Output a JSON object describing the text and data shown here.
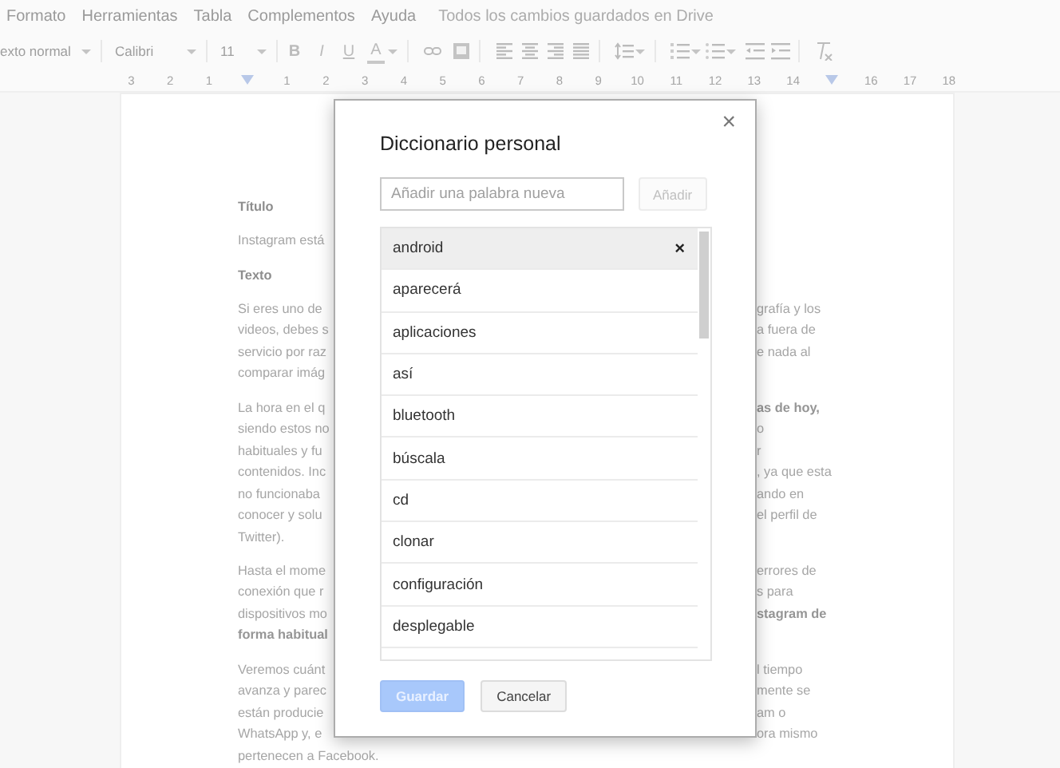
{
  "menu": [
    "Formato",
    "Herramientas",
    "Tabla",
    "Complementos",
    "Ayuda"
  ],
  "save_status": "Todos los cambios guardados en Drive",
  "toolbar": {
    "style": "exto normal",
    "font": "Calibri",
    "size": "11",
    "format_buttons": [
      "B",
      "I",
      "U",
      "A"
    ]
  },
  "ruler": [
    "3",
    "2",
    "1",
    "1",
    "2",
    "3",
    "4",
    "5",
    "6",
    "7",
    "8",
    "9",
    "10",
    "11",
    "12",
    "13",
    "14",
    "16",
    "17",
    "18"
  ],
  "document": [
    {
      "kind": "heading",
      "lines": [
        {
          "left": {
            "text": "Título",
            "bold": true
          }
        }
      ]
    },
    {
      "kind": "body",
      "lines": [
        {
          "left": {
            "text": "Instagram está",
            "bold": false
          }
        }
      ]
    },
    {
      "kind": "heading",
      "lines": [
        {
          "left": {
            "text": "Texto",
            "bold": true
          }
        }
      ]
    },
    {
      "kind": "body",
      "lines": [
        {
          "left": {
            "text": "Si eres uno de",
            "bold": false
          },
          "right": {
            "text": "grafía y los",
            "bold": false
          }
        },
        {
          "left": {
            "text": "videos, debes s",
            "bold": false
          },
          "right": {
            "text": "a fuera de",
            "bold": false
          }
        },
        {
          "left": {
            "text": "servicio por raz",
            "bold": false
          },
          "right": {
            "text": "e nada al",
            "bold": false
          }
        },
        {
          "left": {
            "text": "comparar imág",
            "bold": false
          }
        }
      ]
    },
    {
      "kind": "body",
      "lines": [
        {
          "left": {
            "text": "La hora en el q",
            "bold": false
          },
          "right": {
            "text": "as de hoy,",
            "bold": true
          }
        },
        {
          "left": {
            "text": "siendo estos no",
            "bold": false
          },
          "right": {
            "text": "o",
            "bold": false
          }
        },
        {
          "left": {
            "text": "habituales y fu",
            "bold": false
          },
          "right": {
            "text": "r",
            "bold": false
          }
        },
        {
          "left": {
            "text": "contenidos. Inc",
            "bold": false
          },
          "right": {
            "text": ", ya que esta",
            "bold": false
          }
        },
        {
          "left": {
            "text": "no funcionaba",
            "bold": false
          },
          "right": {
            "text": "ando en",
            "bold": false
          }
        },
        {
          "left": {
            "text": "conocer y solu",
            "bold": false
          },
          "right": {
            "text": "el perfil de",
            "bold": false
          }
        },
        {
          "left": {
            "text": "Twitter).",
            "bold": false
          }
        }
      ]
    },
    {
      "kind": "body",
      "lines": [
        {
          "left": {
            "text": "Hasta el mome",
            "bold": false
          },
          "right": {
            "text": "errores de",
            "bold": false
          }
        },
        {
          "left": {
            "text": "conexión que r",
            "bold": false
          },
          "right": {
            "text": "s para",
            "bold": false
          }
        },
        {
          "left": {
            "text": "dispositivos mo",
            "bold": false
          },
          "right": {
            "text": "stagram de",
            "bold": true
          }
        },
        {
          "left": {
            "text": "forma habitual",
            "bold": true
          }
        }
      ]
    },
    {
      "kind": "body",
      "lines": [
        {
          "left": {
            "text": "Veremos cuánt",
            "bold": false
          },
          "right": {
            "text": "l tiempo",
            "bold": false
          }
        },
        {
          "left": {
            "text": "avanza y parec",
            "bold": false
          },
          "right": {
            "text": "mente se",
            "bold": false
          }
        },
        {
          "left": {
            "text": "están producie",
            "bold": false
          },
          "right": {
            "text": "am o",
            "bold": false
          }
        },
        {
          "left": {
            "text": "WhatsApp y, e",
            "bold": false
          },
          "right": {
            "text": "ora mismo",
            "bold": false
          }
        },
        {
          "left": {
            "text": "pertenecen a Facebook.",
            "bold": false
          }
        }
      ]
    }
  ],
  "dialog": {
    "title": "Diccionario personal",
    "close": "×",
    "new_word": {
      "placeholder": "Añadir una palabra nueva"
    },
    "add_button": {
      "label": "Añadir",
      "disabled": true
    },
    "words": [
      {
        "word": "android",
        "selected": true
      },
      {
        "word": "aparecerá",
        "selected": false
      },
      {
        "word": "aplicaciones",
        "selected": false
      },
      {
        "word": "así",
        "selected": false
      },
      {
        "word": "bluetooth",
        "selected": false
      },
      {
        "word": "búscala",
        "selected": false
      },
      {
        "word": "cd",
        "selected": false
      },
      {
        "word": "clonar",
        "selected": false
      },
      {
        "word": "configuración",
        "selected": false
      },
      {
        "word": "desplegable",
        "selected": false
      }
    ],
    "delete_mark": "×",
    "buttons": [
      {
        "label": "Guardar",
        "kind": "primary",
        "disabled": true
      },
      {
        "label": "Cancelar",
        "kind": "secondary",
        "disabled": false
      }
    ]
  }
}
